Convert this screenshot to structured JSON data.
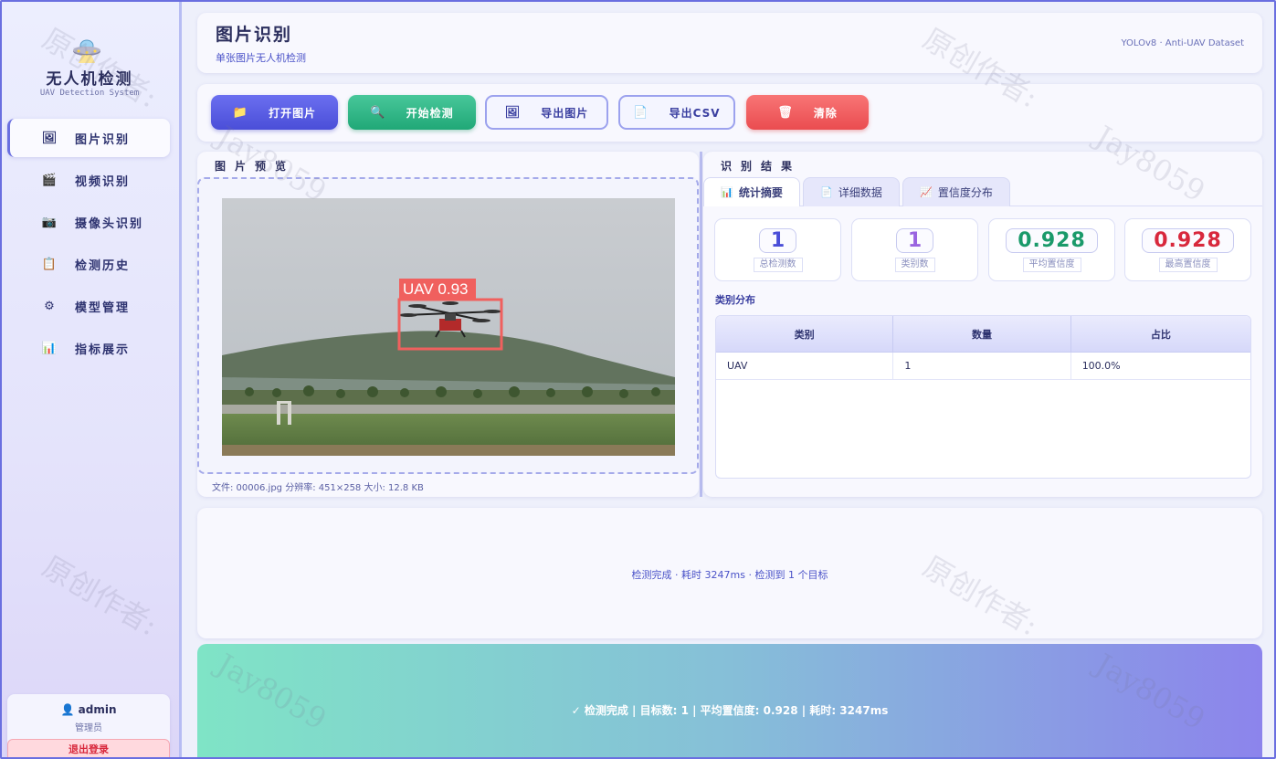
{
  "app": {
    "logo_title": "无人机检测",
    "logo_subtitle": "UAV Detection System"
  },
  "sidebar": {
    "items": [
      {
        "label": "图片识别",
        "icon": "🖼",
        "active": true
      },
      {
        "label": "视频识别",
        "icon": "🎬",
        "active": false
      },
      {
        "label": "摄像头识别",
        "icon": "📷",
        "active": false
      },
      {
        "label": "检测历史",
        "icon": "📋",
        "active": false
      },
      {
        "label": "模型管理",
        "icon": "⚙",
        "active": false
      },
      {
        "label": "指标展示",
        "icon": "📊",
        "active": false
      }
    ],
    "user": {
      "name": "admin",
      "role": "管理员",
      "logout": "退出登录"
    }
  },
  "header": {
    "title": "图片识别",
    "subtitle": "单张图片无人机检测",
    "dataset": "YOLOv8 · Anti-UAV Dataset"
  },
  "toolbar": {
    "open_label": "打开图片",
    "detect_label": "开始检测",
    "export_img_label": "导出图片",
    "export_csv_label": "导出CSV",
    "clear_label": "清除"
  },
  "preview": {
    "title": "图片预览",
    "detection_label": "UAV 0.93",
    "file_info": "文件: 00006.jpg   分辨率: 451×258   大小: 12.8 KB"
  },
  "results": {
    "title": "识别结果",
    "tabs": [
      {
        "label": "统计摘要",
        "icon": "📊",
        "active": true
      },
      {
        "label": "详细数据",
        "icon": "📄",
        "active": false
      },
      {
        "label": "置信度分布",
        "icon": "📈",
        "active": false
      }
    ],
    "stats": [
      {
        "value": "1",
        "label": "总检测数"
      },
      {
        "value": "1",
        "label": "类别数"
      },
      {
        "value": "0.928",
        "label": "平均置信度"
      },
      {
        "value": "0.928",
        "label": "最高置信度"
      }
    ],
    "distribution_title": "类别分布",
    "table": {
      "headers": [
        "类别",
        "数量",
        "占比"
      ],
      "rows": [
        [
          "UAV",
          "1",
          "100.0%"
        ]
      ]
    }
  },
  "log": {
    "message": "检测完成 · 耗时 3247ms · 检测到 1 个目标"
  },
  "status": {
    "message": "✓  检测完成 | 目标数: 1 | 平均置信度: 0.928 | 耗时: 3247ms"
  },
  "watermark": {
    "text1": "原创作者:",
    "text2": "Jay8059"
  },
  "colors": {
    "accent": "#4a4ed8",
    "success": "#20a877",
    "danger": "#ea4c50",
    "bbox": "#f0605e"
  }
}
